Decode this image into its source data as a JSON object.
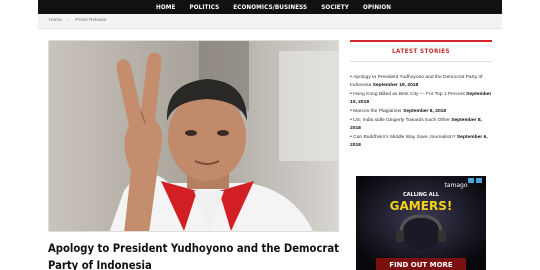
{
  "nav": {
    "items": [
      "HOME",
      "POLITICS",
      "ECONOMICS/BUSINESS",
      "SOCIETY",
      "OPINION"
    ]
  },
  "breadcrumb": {
    "home": "Home",
    "current": "Press Release"
  },
  "article": {
    "title": "Apology to President Yudhoyono and the Democrat Party of Indonesia"
  },
  "sidebar": {
    "heading": "LATEST STORIES",
    "stories": [
      {
        "title": "Apology to President Yudhoyono and the Democrat Party of Indonesia",
        "date": "September 19, 2018"
      },
      {
        "title": "Hong Kong Billed as Best City — For Top 1 Percent",
        "date": "September 10, 2018"
      },
      {
        "title": "Marcos the Plagiarizer",
        "date": "September 8, 2018"
      },
      {
        "title": "US, India sidle Gingerly Towards Each Other",
        "date": "September 8, 2018"
      },
      {
        "title": "Can Buddhism's Middle Way Save Journalism?",
        "date": "September 6, 2018"
      }
    ]
  },
  "ad": {
    "brand": "tamago",
    "tagline": "CALLING ALL",
    "headline": "GAMERS!",
    "cta": "FIND OUT MORE"
  },
  "colors": {
    "accent": "#d32b2b",
    "topbar": "#111111",
    "crumb_bg": "#f3f3f3"
  }
}
